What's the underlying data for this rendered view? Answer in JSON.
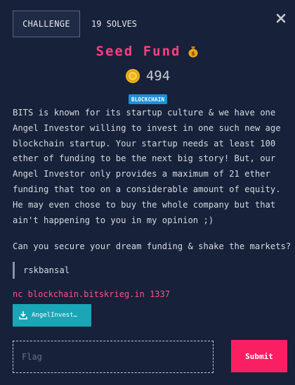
{
  "tabs": {
    "challenge": "CHALLENGE",
    "solves": "19 SOLVES"
  },
  "challenge": {
    "title": "Seed Fund",
    "title_icon": "money-bag-icon",
    "points_icon": "coin-icon",
    "points": "494",
    "category": "BLOCKCHAIN",
    "description": "BITS is known for its startup culture & we have one Angel Investor willing to invest in one such new age blockchain startup. Your startup needs at least 100 ether of funding to be the next big story! But, our Angel Investor only provides a maximum of 21 ether funding that too on a considerable amount of equity. He may even chose to buy the whole company but that ain't happening to you in my opinion ;)",
    "question": "Can you secure your dream funding & shake the markets?",
    "author": "rskbansal",
    "connection": "nc blockchain.bitskrieg.in 1337",
    "file_label": "AngelInvest…",
    "file_icon": "download-icon"
  },
  "form": {
    "flag_placeholder": "Flag",
    "flag_value": "",
    "submit_label": "Submit"
  },
  "colors": {
    "background": "#172139",
    "title": "#ff3f80",
    "badge": "#1e8fd8",
    "download_button": "#1aa6b6",
    "submit_button": "#fa1f63",
    "connection_text": "#ff4f87"
  }
}
